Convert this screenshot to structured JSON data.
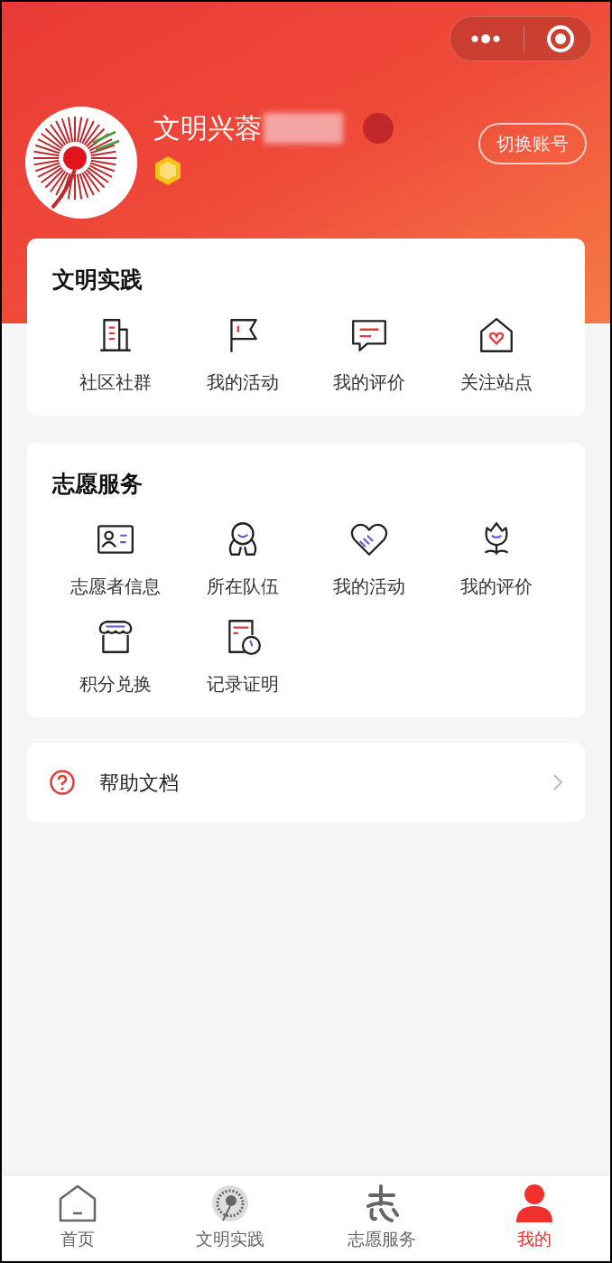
{
  "profile": {
    "name": "文明兴蓉",
    "switch_button": "切换账号"
  },
  "sections": [
    {
      "title": "文明实践",
      "items": [
        "社区社群",
        "我的活动",
        "我的评价",
        "关注站点"
      ]
    },
    {
      "title": "志愿服务",
      "items": [
        "志愿者信息",
        "所在队伍",
        "我的活动",
        "我的评价",
        "积分兑换",
        "记录证明"
      ]
    }
  ],
  "help": {
    "label": "帮助文档"
  },
  "tabs": [
    {
      "label": "首页",
      "selected": false
    },
    {
      "label": "文明实践",
      "selected": false
    },
    {
      "label": "志愿服务",
      "selected": false
    },
    {
      "label": "我的",
      "selected": true
    }
  ]
}
